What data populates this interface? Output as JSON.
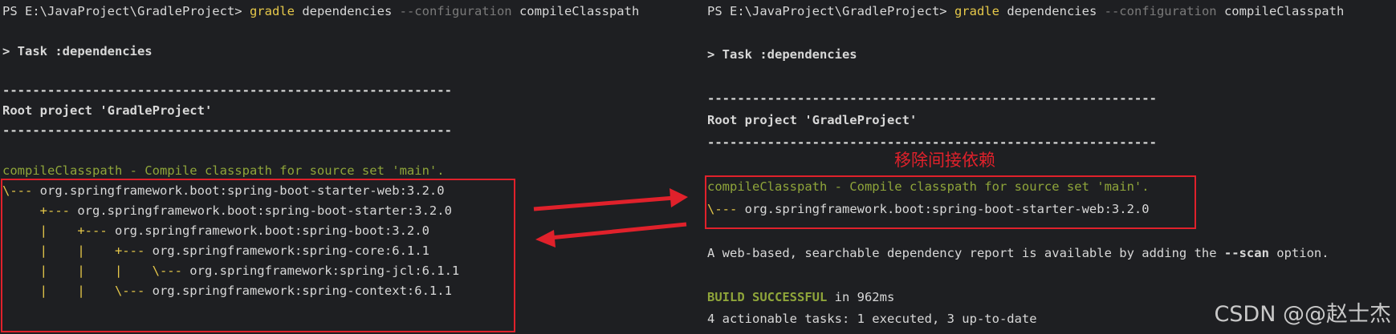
{
  "left": {
    "prompt": "PS E:\\JavaProject\\GradleProject>",
    "cmd": "gradle",
    "arg1": "dependencies",
    "flag": "--configuration",
    "arg2": "compileClasspath",
    "task": "> Task :dependencies",
    "sep": "------------------------------------------------------------",
    "root": "Root project 'GradleProject'",
    "cc_text": "compileClasspath - Compile classpath for source set 'main'.",
    "tree": [
      {
        "prefix": "\\--- ",
        "text": "org.springframework.boot:spring-boot-starter-web:3.2.0"
      },
      {
        "prefix": "     +--- ",
        "text": "org.springframework.boot:spring-boot-starter:3.2.0"
      },
      {
        "prefix": "     |    +--- ",
        "text": "org.springframework.boot:spring-boot:3.2.0"
      },
      {
        "prefix": "     |    |    +--- ",
        "text": "org.springframework:spring-core:6.1.1"
      },
      {
        "prefix": "     |    |    |    \\--- ",
        "text": "org.springframework:spring-jcl:6.1.1"
      },
      {
        "prefix": "     |    |    \\--- ",
        "text": "org.springframework:spring-context:6.1.1"
      }
    ]
  },
  "right": {
    "prompt": "PS E:\\JavaProject\\GradleProject>",
    "cmd": "gradle",
    "arg1": "dependencies",
    "flag": "--configuration",
    "arg2": "compileClasspath",
    "task": "> Task :dependencies",
    "sep": "------------------------------------------------------------",
    "root": "Root project 'GradleProject'",
    "annotation": "移除间接依赖",
    "cc_text": "compileClasspath - Compile classpath for source set 'main'.",
    "tree_prefix": "\\--- ",
    "tree_text": "org.springframework.boot:spring-boot-starter-web:3.2.0",
    "report_a": "A web-based, searchable dependency report is available by adding the ",
    "report_b": "--scan",
    "report_c": " option.",
    "build_a": "BUILD SUCCESSFUL",
    "build_b": " in 962ms",
    "tasks": "4 actionable tasks: 1 executed, 3 up-to-date"
  },
  "watermark": "CSDN @@赵士杰",
  "colors": {
    "background": "#1e1f22",
    "highlight_box": "#e0212b",
    "command": "#e6c84a",
    "success": "#8fa53a"
  }
}
